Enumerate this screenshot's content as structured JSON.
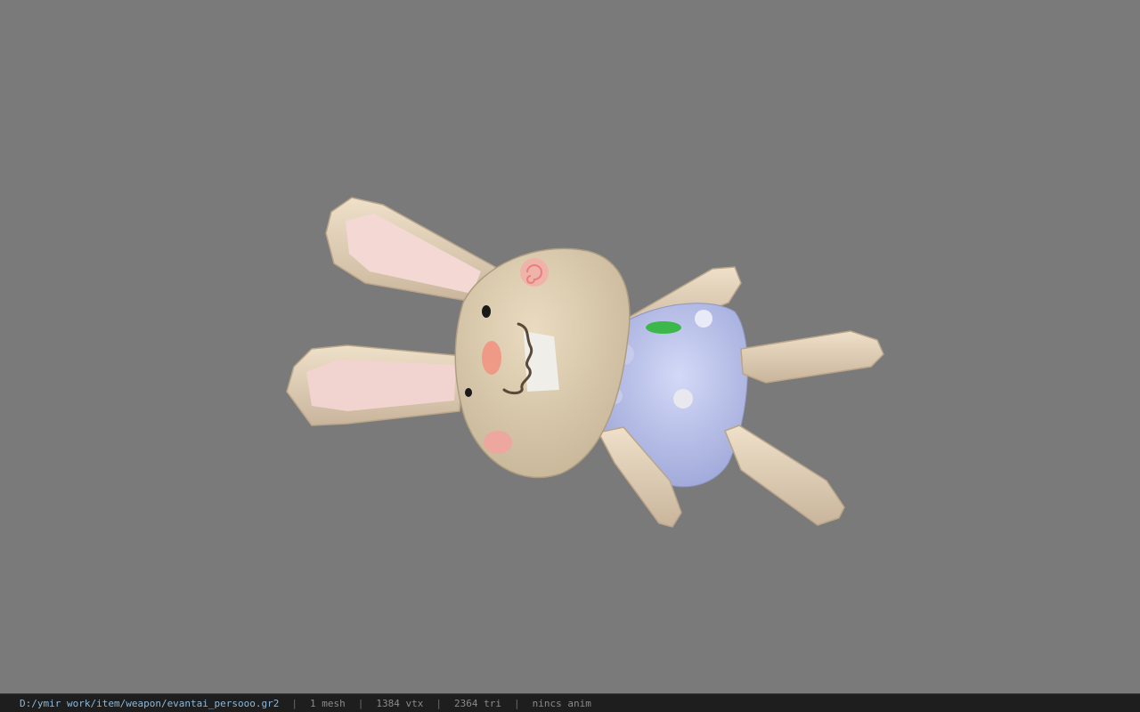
{
  "viewer": {
    "background_color": "#7a7a7a",
    "model_icon": "bunny-fan-model"
  },
  "statusbar": {
    "path": "D:/ymir work/item/weapon/evantai_persooo.gr2",
    "separator": "|",
    "mesh_count": "1 mesh",
    "vertex_count": "1384 vtx",
    "triangle_count": "2364 tri",
    "anim": "nincs anim"
  }
}
